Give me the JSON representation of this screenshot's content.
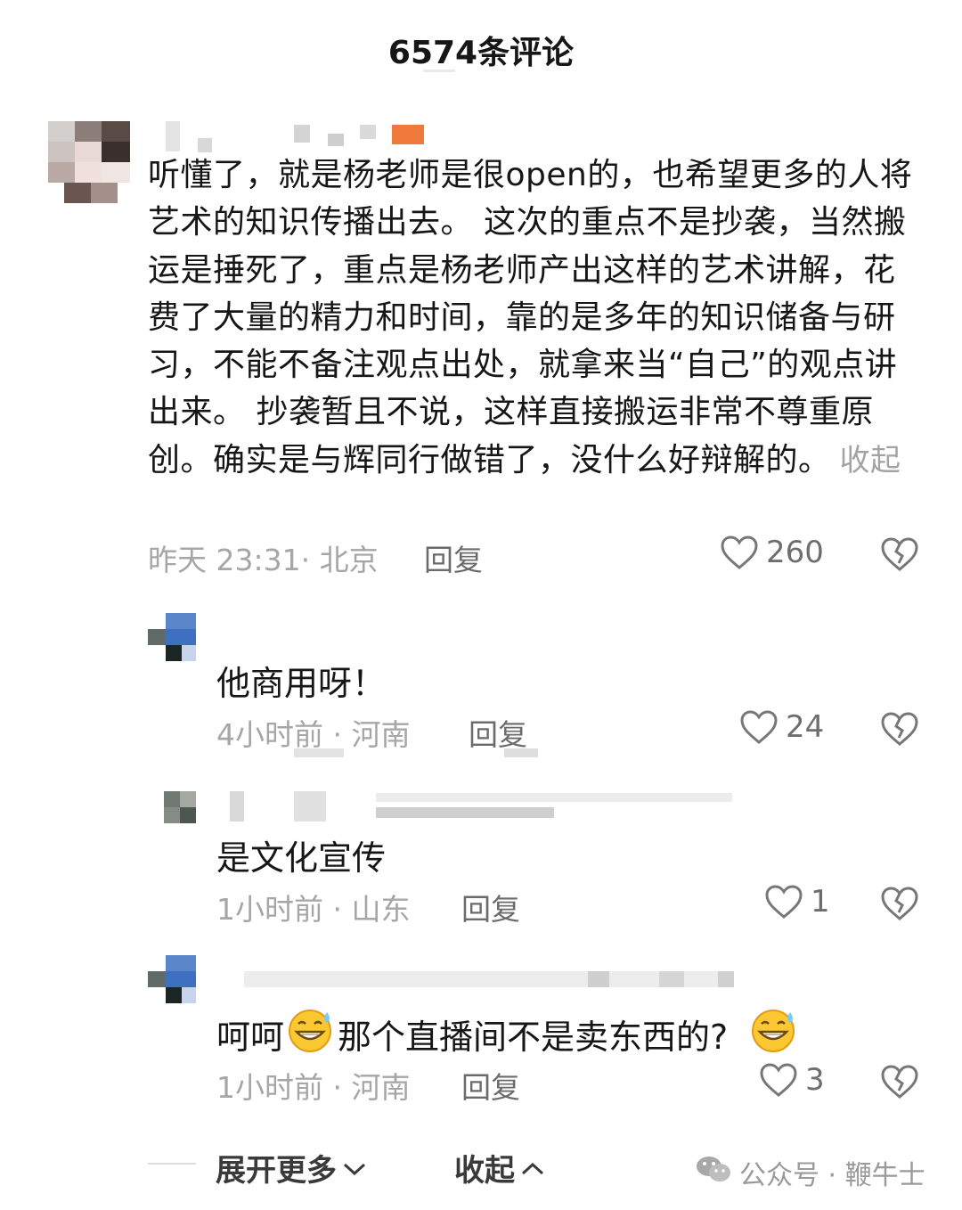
{
  "header": {
    "title": "6574条评论"
  },
  "comment": {
    "text": "听懂了，就是杨老师是很open的，也希望更多的人将艺术的知识传播出去。 这次的重点不是抄袭，当然搬运是捶死了，重点是杨老师产出这样的艺术讲解，花费了大量的精力和时间，靠的是多年的知识储备与研习，不能不备注观点出处，就拿来当“自己”的观点讲出来。 抄袭暂且不说，这样直接搬运非常不尊重原创。确实是与辉同行做错了，没什么好辩解的。",
    "collapse_label": "收起",
    "meta": "昨天 23:31· 北京",
    "reply_label": "回复",
    "likes": "260"
  },
  "replies": [
    {
      "text": "他商用呀！",
      "meta": "4小时前 · 河南",
      "reply_label": "回复",
      "likes": "24"
    },
    {
      "text": "是文化宣传",
      "meta": "1小时前 · 山东",
      "reply_label": "回复",
      "likes": "1"
    },
    {
      "text_before": "呵呵",
      "text_after": "那个直播间不是卖东西的?",
      "meta": "1小时前 · 河南",
      "reply_label": "回复",
      "likes": "3"
    }
  ],
  "footer": {
    "expand_label": "展开更多",
    "collapse_label": "收起",
    "watermark": "公众号 · 鞭牛士"
  },
  "colors": {
    "text": "#161616",
    "muted": "#a6a6a6",
    "reply": "#6b6b6b"
  },
  "icons": [
    "heart-outline-icon",
    "broken-heart-icon",
    "chevron-down-icon",
    "chevron-up-icon",
    "grin-sweat-emoji-icon",
    "wechat-icon"
  ]
}
